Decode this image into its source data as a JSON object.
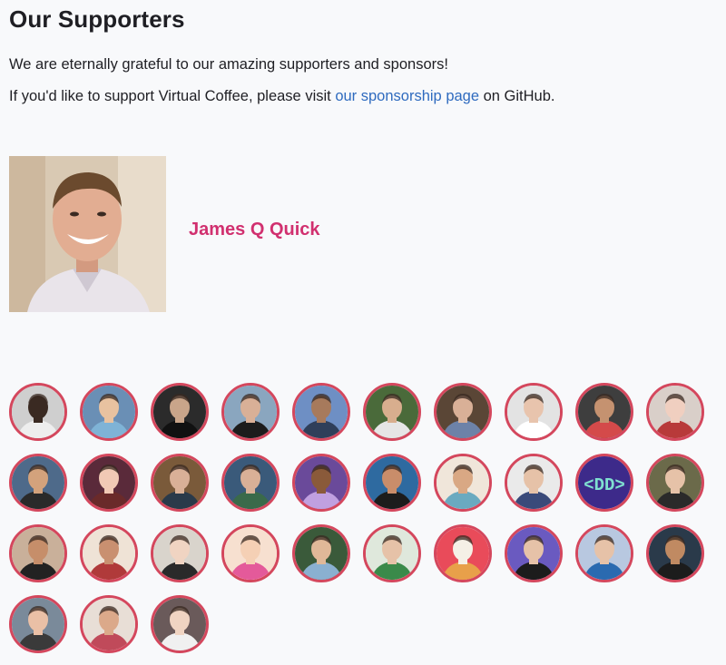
{
  "page": {
    "title": "Our Supporters",
    "intro": "We are eternally grateful to our amazing supporters and sponsors!",
    "cta_prefix": "If you'd like to support Virtual Coffee, please visit ",
    "cta_link": "our sponsorship page",
    "cta_suffix": " on GitHub."
  },
  "featured_sponsor": {
    "name": "James Q Quick",
    "photo_bg": "#d8c8b2"
  },
  "accent": "#d1306f",
  "link_color": "#2f6bbf",
  "avatar_border": "#d4475d",
  "supporters": [
    {
      "bg": "#cfcfcf",
      "skin": "#3a2a22",
      "shirt": "#eeeeee"
    },
    {
      "bg": "#6a8fb5",
      "skin": "#e8c2a0",
      "shirt": "#7fb3d6"
    },
    {
      "bg": "#2b2b2b",
      "skin": "#c9a58a",
      "shirt": "#111111"
    },
    {
      "bg": "#8aa6bf",
      "skin": "#d9b097",
      "shirt": "#1c1c1c"
    },
    {
      "bg": "#6e8fc4",
      "skin": "#a77a5c",
      "shirt": "#2f3f5a"
    },
    {
      "bg": "#4a6a3a",
      "skin": "#d8ae8e",
      "shirt": "#e6e6e6"
    },
    {
      "bg": "#5a4636",
      "skin": "#d9b097",
      "shirt": "#6d82a8"
    },
    {
      "bg": "#e3e3e3",
      "skin": "#e8c4ad",
      "shirt": "#ffffff"
    },
    {
      "bg": "#3e3e3e",
      "skin": "#c59270",
      "shirt": "#d44a4a"
    },
    {
      "bg": "#d9cfc9",
      "skin": "#f0cfc0",
      "shirt": "#b83a3a"
    },
    {
      "bg": "#4e6a8a",
      "skin": "#d3a27c",
      "shirt": "#2a2a2a"
    },
    {
      "bg": "#5a2a3a",
      "skin": "#f1c9b5",
      "shirt": "#6a2a2a"
    },
    {
      "bg": "#7a5a3a",
      "skin": "#d9b097",
      "shirt": "#2a3a4a"
    },
    {
      "bg": "#3a5a7a",
      "skin": "#d9b097",
      "shirt": "#3a6a4a"
    },
    {
      "bg": "#6a4a9a",
      "skin": "#8a5a3a",
      "shirt": "#c0a0e0"
    },
    {
      "bg": "#2e6aa0",
      "skin": "#c98d6a",
      "shirt": "#1c1c1c"
    },
    {
      "bg": "#f0e6da",
      "skin": "#d9a884",
      "shirt": "#6aaac0"
    },
    {
      "bg": "#eaeaea",
      "skin": "#e6c2a8",
      "shirt": "#3a4a7a"
    },
    {
      "bg": "#3d2a8a",
      "text": "<DD>"
    },
    {
      "bg": "#6b6a4a",
      "skin": "#e6c2a8",
      "shirt": "#2a2a2a"
    },
    {
      "bg": "#c9b09a",
      "skin": "#c68e6a",
      "shirt": "#222222"
    },
    {
      "bg": "#efe3d6",
      "skin": "#c99070",
      "shirt": "#b03a3a"
    },
    {
      "bg": "#d9d4cc",
      "skin": "#f0d4c2",
      "shirt": "#2a2a2a"
    },
    {
      "bg": "#f7e0d0",
      "skin": "#f5d0b5",
      "shirt": "#e45a9a"
    },
    {
      "bg": "#3a5a3a",
      "skin": "#e0b898",
      "shirt": "#8ab0d0"
    },
    {
      "bg": "#dfe8dc",
      "skin": "#e6c2a8",
      "shirt": "#3a8a4a"
    },
    {
      "bg": "#e94b5a",
      "skin": "#f5f0e6",
      "shirt": "#e8a04a"
    },
    {
      "bg": "#6a5ac0",
      "skin": "#e6c2a8",
      "shirt": "#1c1c1c"
    },
    {
      "bg": "#b8c8e0",
      "skin": "#e6c2a8",
      "shirt": "#2a6ab0"
    },
    {
      "bg": "#2a3a4a",
      "skin": "#c08a62",
      "shirt": "#1c1c1c"
    },
    {
      "bg": "#7a8a9a",
      "skin": "#eac0a6",
      "shirt": "#3a3a3a"
    },
    {
      "bg": "#e8ded6",
      "skin": "#dba98a",
      "shirt": "#c04a5a"
    },
    {
      "bg": "#6a5a5a",
      "skin": "#f0d4c2",
      "shirt": "#f0f0f0"
    }
  ]
}
